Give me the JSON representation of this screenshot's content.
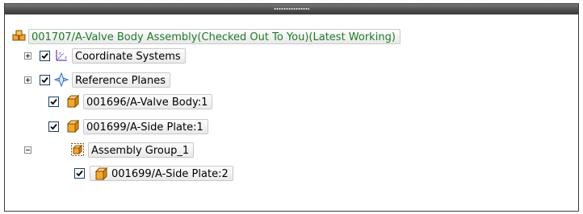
{
  "tree": {
    "root": {
      "label": "001707/A-Valve Body Assembly(Checked Out To You)(Latest Working)",
      "icon": "assembly-icon",
      "color": "#1f7a2a"
    },
    "items": [
      {
        "label": "Coordinate Systems",
        "icon": "coordinate-systems-icon",
        "checked": true,
        "expander": "plus"
      },
      {
        "label": "Reference Planes",
        "icon": "reference-planes-icon",
        "checked": true,
        "expander": "plus"
      },
      {
        "label": "001696/A-Valve Body:1",
        "icon": "part-icon",
        "checked": true
      },
      {
        "label": "001699/A-Side Plate:1",
        "icon": "part-icon",
        "checked": true
      },
      {
        "label": "Assembly Group_1",
        "icon": "assembly-group-icon",
        "expander": "minus"
      },
      {
        "label": "001699/A-Side Plate:2",
        "icon": "part-icon",
        "checked": true
      }
    ]
  }
}
